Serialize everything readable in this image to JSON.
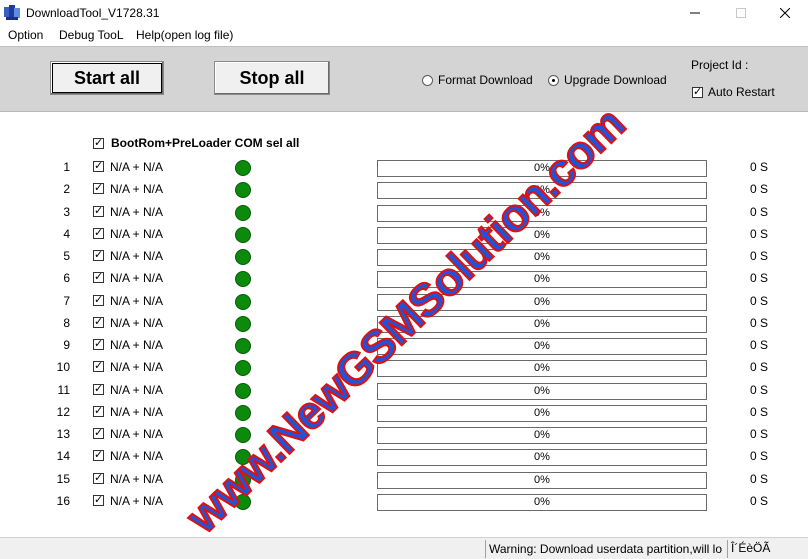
{
  "window": {
    "title": "DownloadTool_V1728.31",
    "minimize_glyph": "—",
    "maximize_glyph": "☐",
    "close_glyph": "✕"
  },
  "menu": {
    "items": [
      "Option",
      "Debug TooL",
      "Help(open log file)"
    ]
  },
  "toolbar": {
    "start_label": "Start all",
    "stop_label": "Stop all",
    "format_download_label": "Format Download",
    "upgrade_download_label": "Upgrade Download",
    "selected_mode": "Upgrade Download",
    "project_id_label": "Project Id :",
    "auto_restart_label": "Auto Restart",
    "auto_restart_checked": true
  },
  "sel_all": {
    "label": "BootRom+PreLoader COM sel all",
    "checked": true
  },
  "ports": [
    {
      "num": "1",
      "port": "N/A + N/A",
      "checked": true,
      "progress": "0%",
      "time": "0 S"
    },
    {
      "num": "2",
      "port": "N/A + N/A",
      "checked": true,
      "progress": "0%",
      "time": "0 S"
    },
    {
      "num": "3",
      "port": "N/A + N/A",
      "checked": true,
      "progress": "0%",
      "time": "0 S"
    },
    {
      "num": "4",
      "port": "N/A + N/A",
      "checked": true,
      "progress": "0%",
      "time": "0 S"
    },
    {
      "num": "5",
      "port": "N/A + N/A",
      "checked": true,
      "progress": "0%",
      "time": "0 S"
    },
    {
      "num": "6",
      "port": "N/A + N/A",
      "checked": true,
      "progress": "0%",
      "time": "0 S"
    },
    {
      "num": "7",
      "port": "N/A + N/A",
      "checked": true,
      "progress": "0%",
      "time": "0 S"
    },
    {
      "num": "8",
      "port": "N/A + N/A",
      "checked": true,
      "progress": "0%",
      "time": "0 S"
    },
    {
      "num": "9",
      "port": "N/A + N/A",
      "checked": true,
      "progress": "0%",
      "time": "0 S"
    },
    {
      "num": "10",
      "port": "N/A + N/A",
      "checked": true,
      "progress": "0%",
      "time": "0 S"
    },
    {
      "num": "11",
      "port": "N/A + N/A",
      "checked": true,
      "progress": "0%",
      "time": "0 S"
    },
    {
      "num": "12",
      "port": "N/A + N/A",
      "checked": true,
      "progress": "0%",
      "time": "0 S"
    },
    {
      "num": "13",
      "port": "N/A + N/A",
      "checked": true,
      "progress": "0%",
      "time": "0 S"
    },
    {
      "num": "14",
      "port": "N/A + N/A",
      "checked": true,
      "progress": "0%",
      "time": "0 S"
    },
    {
      "num": "15",
      "port": "N/A + N/A",
      "checked": true,
      "progress": "0%",
      "time": "0 S"
    },
    {
      "num": "16",
      "port": "N/A + N/A",
      "checked": true,
      "progress": "0%",
      "time": "0 S"
    }
  ],
  "status_bar": {
    "warning": "Warning: Download userdata partition,will lo",
    "code": "Î´ÉèÖÃ"
  },
  "watermark": {
    "text": "www.NewGSMSolution.com"
  },
  "colors": {
    "led_ok": "#0b8a0b",
    "toolbar_bg": "#d4d4d4",
    "watermark_fill": "#2452d6",
    "watermark_stroke": "#e01010",
    "progress_fill": "#2d9d2d"
  }
}
